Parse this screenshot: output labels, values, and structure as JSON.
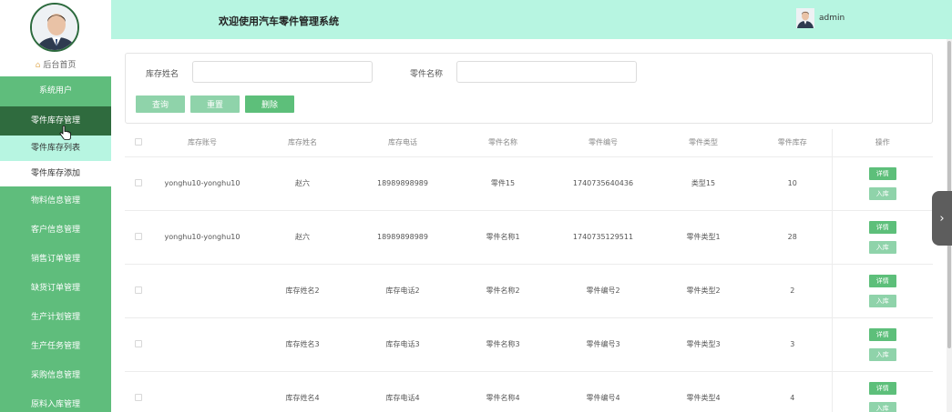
{
  "app": {
    "title": "欢迎使用汽车零件管理系统",
    "username": "admin"
  },
  "colors": {
    "primary_green": "#5fbd7c",
    "active_green": "#2f6b3e",
    "header_mint": "#b7f5e1",
    "button_light_green": "#8fd3aa",
    "button_green": "#5dbf7a"
  },
  "sidebar": {
    "home_label": "后台首页",
    "items": [
      {
        "label": "系统用户"
      },
      {
        "label": "零件库存管理"
      },
      {
        "label": "零件库存列表"
      },
      {
        "label": "零件库存添加"
      },
      {
        "label": "物料信息管理"
      },
      {
        "label": "客户信息管理"
      },
      {
        "label": "销售订单管理"
      },
      {
        "label": "缺货订单管理"
      },
      {
        "label": "生产计划管理"
      },
      {
        "label": "生产任务管理"
      },
      {
        "label": "采购信息管理"
      },
      {
        "label": "原料入库管理"
      }
    ]
  },
  "search": {
    "field1_label": "库存姓名",
    "field1_value": "",
    "field2_label": "零件名称",
    "field2_value": "",
    "query_button": "查询",
    "reset_button": "重置",
    "delete_button": "删除"
  },
  "table": {
    "headers": [
      "库存账号",
      "库存姓名",
      "库存电话",
      "零件名称",
      "零件编号",
      "零件类型",
      "零件库存",
      "操作"
    ],
    "detail_label": "详情",
    "stock_in_label": "入库",
    "rows": [
      {
        "account": "yonghu10-yonghu10",
        "name": "赵六",
        "phone": "18989898989",
        "part_name": "零件15",
        "part_no": "1740735640436",
        "part_type": "类型15",
        "stock": "10"
      },
      {
        "account": "yonghu10-yonghu10",
        "name": "赵六",
        "phone": "18989898989",
        "part_name": "零件名称1",
        "part_no": "1740735129511",
        "part_type": "零件类型1",
        "stock": "28"
      },
      {
        "account": "",
        "name": "库存姓名2",
        "phone": "库存电话2",
        "part_name": "零件名称2",
        "part_no": "零件编号2",
        "part_type": "零件类型2",
        "stock": "2"
      },
      {
        "account": "",
        "name": "库存姓名3",
        "phone": "库存电话3",
        "part_name": "零件名称3",
        "part_no": "零件编号3",
        "part_type": "零件类型3",
        "stock": "3"
      },
      {
        "account": "",
        "name": "库存姓名4",
        "phone": "库存电话4",
        "part_name": "零件名称4",
        "part_no": "零件编号4",
        "part_type": "零件类型4",
        "stock": "4"
      }
    ]
  }
}
